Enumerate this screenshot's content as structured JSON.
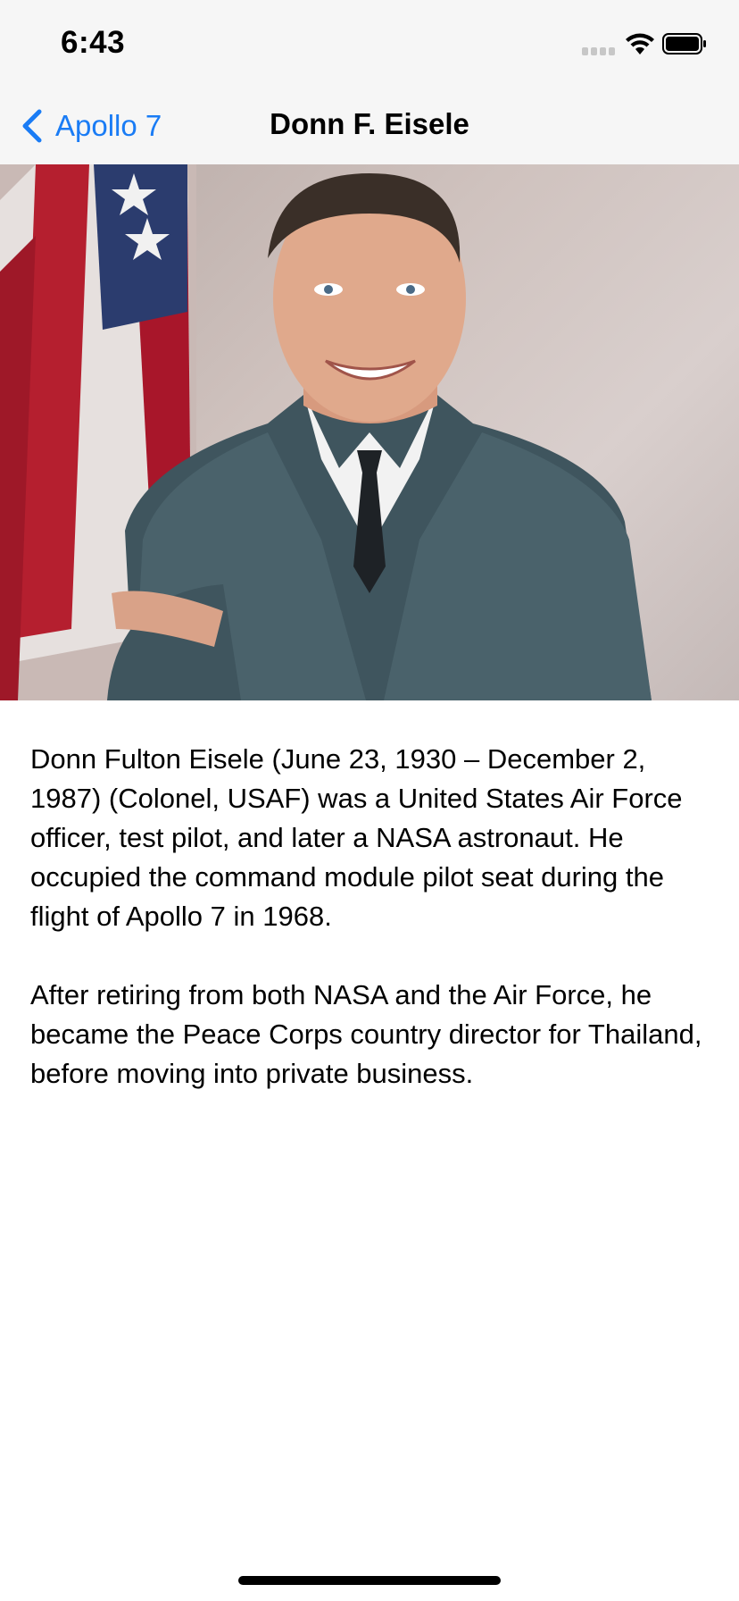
{
  "status_bar": {
    "time": "6:43",
    "icons": [
      "cellular-signal-icon",
      "wifi-icon",
      "battery-icon"
    ]
  },
  "nav": {
    "back_label": "Apollo 7",
    "title": "Donn F. Eisele",
    "accent_color": "#1a7cf5"
  },
  "portrait": {
    "subject": "astronaut-portrait"
  },
  "bio": {
    "paragraphs": [
      "Donn Fulton Eisele (June 23, 1930 – December 2, 1987) (Colonel, USAF) was a United States Air Force officer, test pilot, and later a NASA astronaut. He occupied the command module pilot seat during the flight of Apollo 7 in 1968.",
      "After retiring from both NASA and the Air Force, he became the Peace Corps country director for Thailand, before moving into private business."
    ]
  }
}
